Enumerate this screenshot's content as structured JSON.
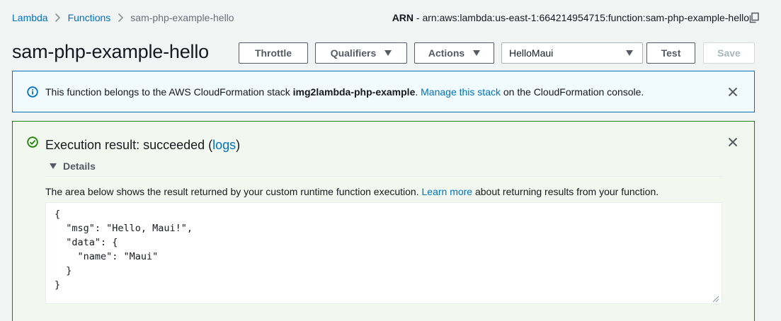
{
  "breadcrumb": {
    "items": [
      {
        "label": "Lambda"
      },
      {
        "label": "Functions"
      },
      {
        "label": "sam-php-example-hello"
      }
    ]
  },
  "arn": {
    "label": "ARN",
    "separator": " - ",
    "value": "arn:aws:lambda:us-east-1:664214954715:function:sam-php-example-hello"
  },
  "header": {
    "title": "sam-php-example-hello",
    "throttle_label": "Throttle",
    "qualifiers_label": "Qualifiers",
    "actions_label": "Actions",
    "test_event_selected": "HelloMaui",
    "test_label": "Test",
    "save_label": "Save"
  },
  "info_flash": {
    "text_before": "This function belongs to the AWS CloudFormation stack ",
    "stack_name": "img2lambda-php-example",
    "text_mid": ". ",
    "link_label": "Manage this stack",
    "text_after": " on the CloudFormation console."
  },
  "execution_result": {
    "title_prefix": "Execution result: succeeded (",
    "logs_link": "logs",
    "title_suffix": ")",
    "details_label": "Details",
    "desc_before": "The area below shows the result returned by your custom runtime function execution. ",
    "learn_more_link": "Learn more",
    "desc_after": " about returning results from your function.",
    "output": "{\n  \"msg\": \"Hello, Maui!\",\n  \"data\": {\n    \"name\": \"Maui\"\n  }\n}"
  },
  "colors": {
    "link": "#0073bb",
    "info_border": "#0073bb",
    "info_bg": "#f1faff",
    "success_border": "#1d8102",
    "success_bg": "#f2f8f0",
    "page_bg": "#f2f3f3"
  }
}
